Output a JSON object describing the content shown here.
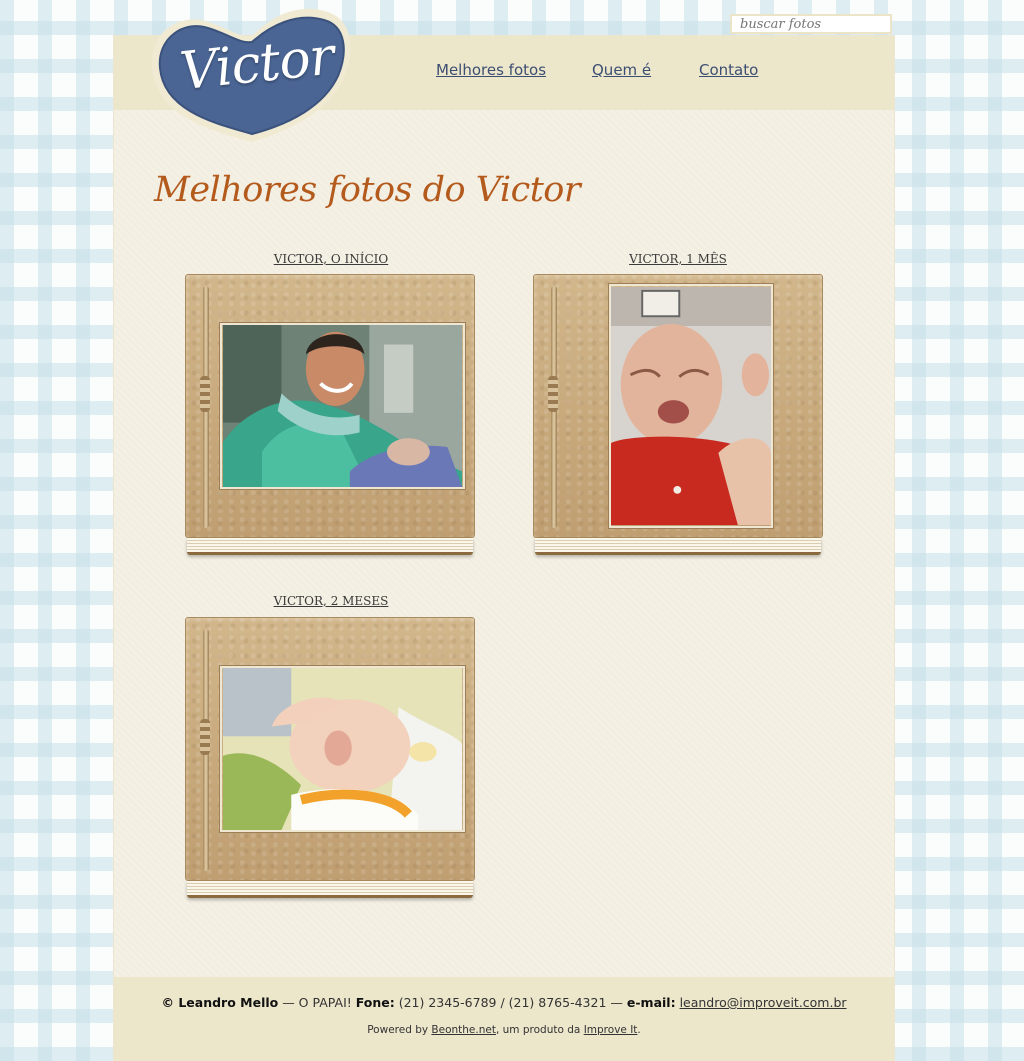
{
  "search": {
    "placeholder": "buscar fotos"
  },
  "logo": {
    "text": "Victor",
    "color": "#4a6594"
  },
  "nav": [
    {
      "label": "Melhores fotos"
    },
    {
      "label": "Quem é"
    },
    {
      "label": "Contato"
    }
  ],
  "page_title": "Melhores fotos do Victor",
  "albums": [
    {
      "title": "VICTOR, O INÍCIO"
    },
    {
      "title": "VICTOR, 1 MÊS"
    },
    {
      "title": "VICTOR, 2 MESES"
    }
  ],
  "footer": {
    "owner": "© Leandro Mello",
    "dash1": " — O PAPAI! ",
    "phone_label": "Fone:",
    "phone_value": " (21) 2345-6789 / (21) 8765-4321 — ",
    "email_label": "e-mail:",
    "email": "leandro@improveit.com.br",
    "powered_prefix": "Powered by ",
    "powered_link": "Beonthe.net",
    "powered_mid": ", um produto da ",
    "company_link": "Improve It",
    "powered_suffix": "."
  },
  "colors": {
    "title_orange": "#b35a1c",
    "nav_blue": "#3c4e72",
    "header_band": "#ece6cb",
    "page_bg": "#f4f0e4"
  }
}
